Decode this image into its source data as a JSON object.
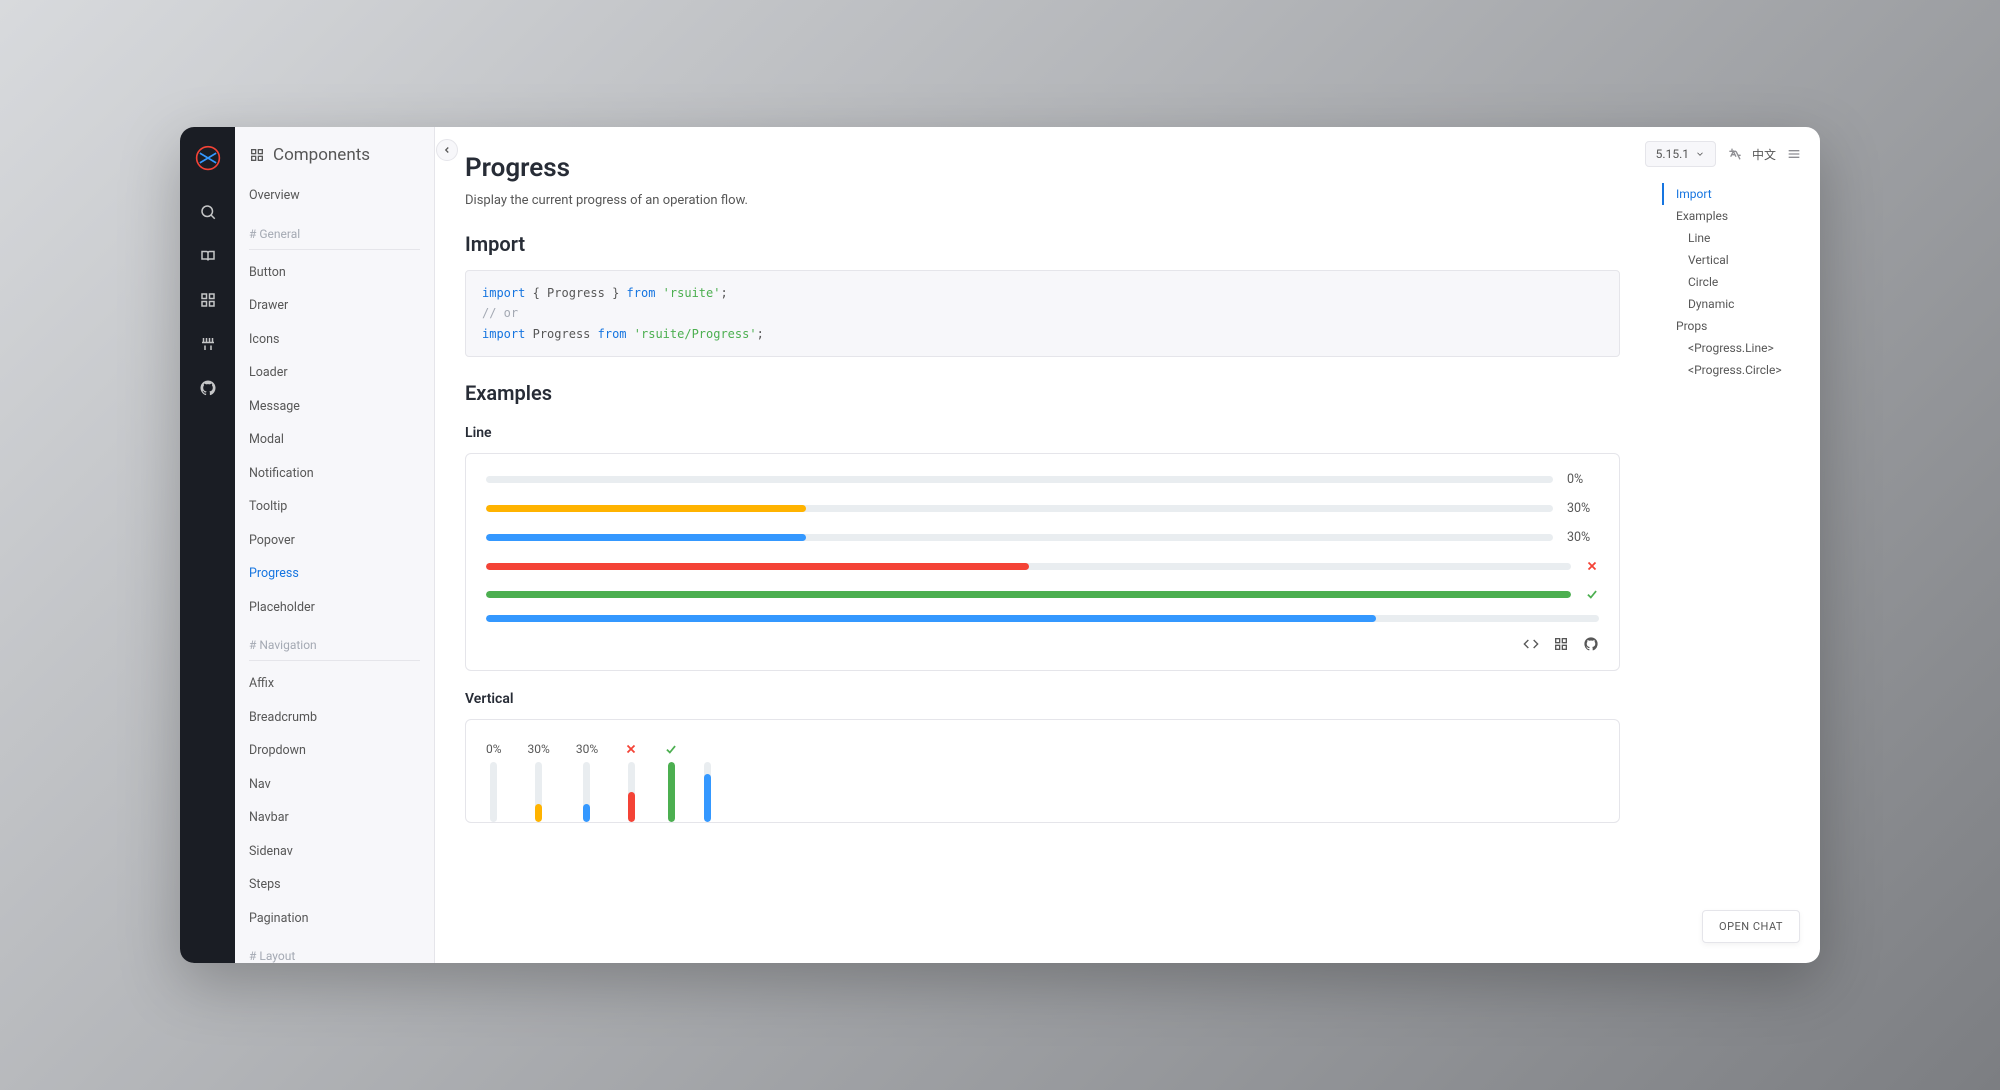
{
  "sidebar": {
    "title": "Components",
    "overview": "Overview",
    "sections": [
      {
        "label": "# General",
        "items": [
          "Button",
          "Drawer",
          "Icons",
          "Loader",
          "Message",
          "Modal",
          "Notification",
          "Tooltip",
          "Popover",
          "Progress",
          "Placeholder"
        ],
        "active_index": 9
      },
      {
        "label": "# Navigation",
        "items": [
          "Affix",
          "Breadcrumb",
          "Dropdown",
          "Nav",
          "Navbar",
          "Sidenav",
          "Steps",
          "Pagination"
        ]
      },
      {
        "label": "# Layout",
        "items": []
      }
    ]
  },
  "topbar": {
    "version": "5.15.1",
    "lang": "中文"
  },
  "page": {
    "title": "Progress",
    "subtitle": "Display the current progress of an operation flow.",
    "import_heading": "Import",
    "code_import_kw": "import",
    "code_from_kw": "from",
    "code_pkg": "'rsuite'",
    "code_or": "// or",
    "code_path": "'rsuite/Progress'",
    "code_sym_open": "{ Progress }",
    "code_sym": "Progress",
    "examples_heading": "Examples",
    "line_heading": "Line",
    "vertical_heading": "Vertical"
  },
  "lines": [
    {
      "percent": 0,
      "color": "#3498ff",
      "label": "0%",
      "status": "label"
    },
    {
      "percent": 30,
      "color": "#ffb300",
      "label": "30%",
      "status": "label"
    },
    {
      "percent": 30,
      "color": "#3498ff",
      "label": "30%",
      "status": "label"
    },
    {
      "percent": 50,
      "color": "#f44336",
      "label": "",
      "status": "fail"
    },
    {
      "percent": 100,
      "color": "#4caf50",
      "label": "",
      "status": "success"
    },
    {
      "percent": 80,
      "color": "#3498ff",
      "label": "",
      "status": "none",
      "showLabel": false
    }
  ],
  "verticals": [
    {
      "percent": 0,
      "color": "#3498ff",
      "label": "0%",
      "status": "label"
    },
    {
      "percent": 30,
      "color": "#ffb300",
      "label": "30%",
      "status": "label"
    },
    {
      "percent": 30,
      "color": "#3498ff",
      "label": "30%",
      "status": "label"
    },
    {
      "percent": 50,
      "color": "#f44336",
      "label": "",
      "status": "fail"
    },
    {
      "percent": 100,
      "color": "#4caf50",
      "label": "",
      "status": "success"
    },
    {
      "percent": 80,
      "color": "#3498ff",
      "label": "",
      "status": "none"
    }
  ],
  "toc": {
    "items": [
      {
        "label": "Import",
        "active": true
      },
      {
        "label": "Examples"
      },
      {
        "label": "Line",
        "sub": true
      },
      {
        "label": "Vertical",
        "sub": true
      },
      {
        "label": "Circle",
        "sub": true
      },
      {
        "label": "Dynamic",
        "sub": true
      },
      {
        "label": "Props"
      },
      {
        "label": "<Progress.Line>",
        "sub": true
      },
      {
        "label": "<Progress.Circle>",
        "sub": true
      }
    ]
  },
  "chat": {
    "label": "OPEN CHAT"
  }
}
